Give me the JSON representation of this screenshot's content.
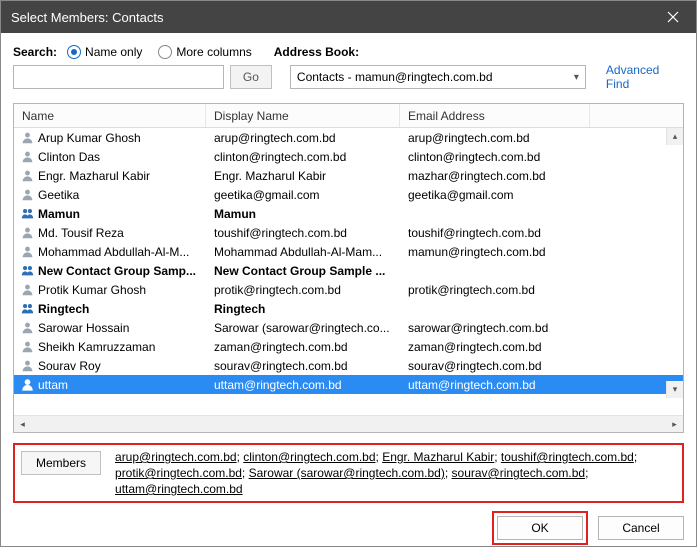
{
  "window": {
    "title": "Select Members: Contacts"
  },
  "search": {
    "label": "Search:",
    "name_only": "Name only",
    "more_columns": "More columns",
    "go": "Go",
    "value": "",
    "addressbook_label": "Address Book:",
    "addressbook_value": "Contacts - mamun@ringtech.com.bd",
    "advanced_find": "Advanced Find"
  },
  "columns": {
    "name": "Name",
    "display": "Display Name",
    "email": "Email Address"
  },
  "rows": [
    {
      "icon": "person",
      "name": "Arup Kumar Ghosh",
      "display": "arup@ringtech.com.bd",
      "email": "arup@ringtech.com.bd"
    },
    {
      "icon": "person",
      "name": "Clinton Das",
      "display": "clinton@ringtech.com.bd",
      "email": "clinton@ringtech.com.bd"
    },
    {
      "icon": "person",
      "name": "Engr. Mazharul Kabir",
      "display": "Engr. Mazharul Kabir",
      "email": "mazhar@ringtech.com.bd"
    },
    {
      "icon": "person",
      "name": "Geetika",
      "display": "geetika@gmail.com",
      "email": "geetika@gmail.com"
    },
    {
      "icon": "group",
      "name": "Mamun",
      "display": "Mamun",
      "email": "",
      "bold": true
    },
    {
      "icon": "person",
      "name": "Md. Tousif Reza",
      "display": "toushif@ringtech.com.bd",
      "email": "toushif@ringtech.com.bd"
    },
    {
      "icon": "person",
      "name": "Mohammad Abdullah-Al-M...",
      "display": "Mohammad Abdullah-Al-Mam...",
      "email": "mamun@ringtech.com.bd"
    },
    {
      "icon": "group",
      "name": "New Contact Group Samp...",
      "display": "New Contact Group Sample ...",
      "email": "",
      "bold": true
    },
    {
      "icon": "person",
      "name": "Protik Kumar Ghosh",
      "display": "protik@ringtech.com.bd",
      "email": "protik@ringtech.com.bd"
    },
    {
      "icon": "group",
      "name": "Ringtech",
      "display": "Ringtech",
      "email": "",
      "bold": true
    },
    {
      "icon": "person",
      "name": "Sarowar Hossain",
      "display": "Sarowar (sarowar@ringtech.co...",
      "email": "sarowar@ringtech.com.bd"
    },
    {
      "icon": "person",
      "name": "Sheikh Kamruzzaman",
      "display": "zaman@ringtech.com.bd",
      "email": "zaman@ringtech.com.bd"
    },
    {
      "icon": "person",
      "name": "Sourav Roy",
      "display": "sourav@ringtech.com.bd",
      "email": "sourav@ringtech.com.bd"
    },
    {
      "icon": "person",
      "name": "uttam",
      "display": "uttam@ringtech.com.bd",
      "email": "uttam@ringtech.com.bd",
      "selected": true
    }
  ],
  "members": {
    "button": "Members",
    "entries": [
      "arup@ringtech.com.bd",
      "clinton@ringtech.com.bd",
      "Engr. Mazharul Kabir",
      "toushif@ringtech.com.bd",
      "protik@ringtech.com.bd",
      "Sarowar (sarowar@ringtech.com.bd)",
      "sourav@ringtech.com.bd",
      "uttam@ringtech.com.bd"
    ]
  },
  "buttons": {
    "ok": "OK",
    "cancel": "Cancel"
  }
}
